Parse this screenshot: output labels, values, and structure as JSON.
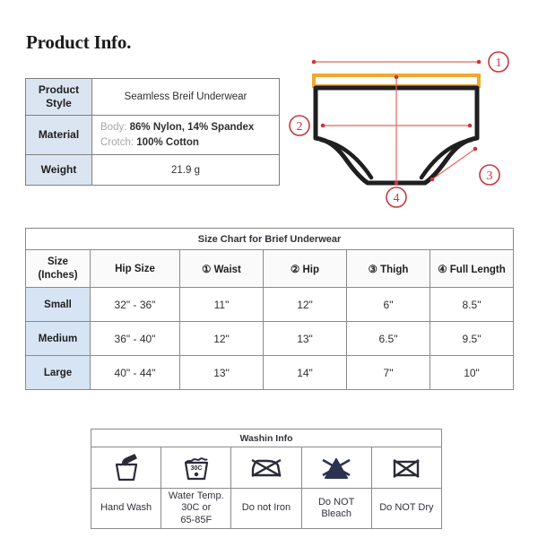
{
  "page": {
    "title": "Product Info."
  },
  "product_info": {
    "rows": [
      {
        "label": "Product Style",
        "label_line1": "Product",
        "label_line2": "Style",
        "value": "Seamless Breif Underwear"
      },
      {
        "label": "Material",
        "material_key1": "Body:",
        "material_val1": "86% Nylon, 14% Spandex",
        "material_key2": "Crotch:",
        "material_val2": "100% Cotton"
      },
      {
        "label": "Weight",
        "value": "21.9 g"
      }
    ]
  },
  "diagram": {
    "markers": [
      "1",
      "2",
      "3",
      "4"
    ],
    "marker_labels": {
      "1": "Waist measurement marker",
      "2": "Hip measurement marker",
      "3": "Thigh measurement marker",
      "4": "Full length measurement marker"
    },
    "colors": {
      "outline": "#1f1f1f",
      "waistband": "#F0A830",
      "measure_line": "#e8635f",
      "marker": "#c7373c"
    }
  },
  "size_chart": {
    "title": "Size Chart for Brief Underwear",
    "columns": [
      "Size (Inches)",
      "Hip Size",
      "① Waist",
      "② Hip",
      "③ Thigh",
      "④ Full Length"
    ],
    "column_size_line1": "Size",
    "column_size_line2": "(Inches)",
    "rows": [
      {
        "size": "Small",
        "hip_size": "32\" - 36\"",
        "waist": "11\"",
        "hip": "12\"",
        "thigh": "6\"",
        "full_length": "8.5\""
      },
      {
        "size": "Medium",
        "hip_size": "36\" - 40\"",
        "waist": "12\"",
        "hip": "13\"",
        "thigh": "6.5\"",
        "full_length": "9.5\""
      },
      {
        "size": "Large",
        "hip_size": "40\" - 44\"",
        "waist": "13\"",
        "hip": "14\"",
        "thigh": "7\"",
        "full_length": "10\""
      }
    ]
  },
  "wash_info": {
    "title": "Washin Info",
    "items": [
      {
        "icon": "hand-wash-icon",
        "label": "Hand Wash",
        "label_line1": "Hand Wash",
        "label_line2": "",
        "label_line3": ""
      },
      {
        "icon": "water-temp-icon",
        "label": "Water Temp. 30C or 65-85F",
        "label_line1": "Water Temp.",
        "label_line2": "30C or",
        "label_line3": "65-85F",
        "temp_text": "30C"
      },
      {
        "icon": "do-not-iron-icon",
        "label": "Do not Iron",
        "label_line1": "Do not Iron",
        "label_line2": "",
        "label_line3": ""
      },
      {
        "icon": "do-not-bleach-icon",
        "label": "Do NOT Bleach",
        "label_line1": "Do NOT",
        "label_line2": "Bleach",
        "label_line3": ""
      },
      {
        "icon": "do-not-dry-icon",
        "label": "Do NOT Dry",
        "label_line1": "Do NOT Dry",
        "label_line2": "",
        "label_line3": ""
      }
    ]
  }
}
